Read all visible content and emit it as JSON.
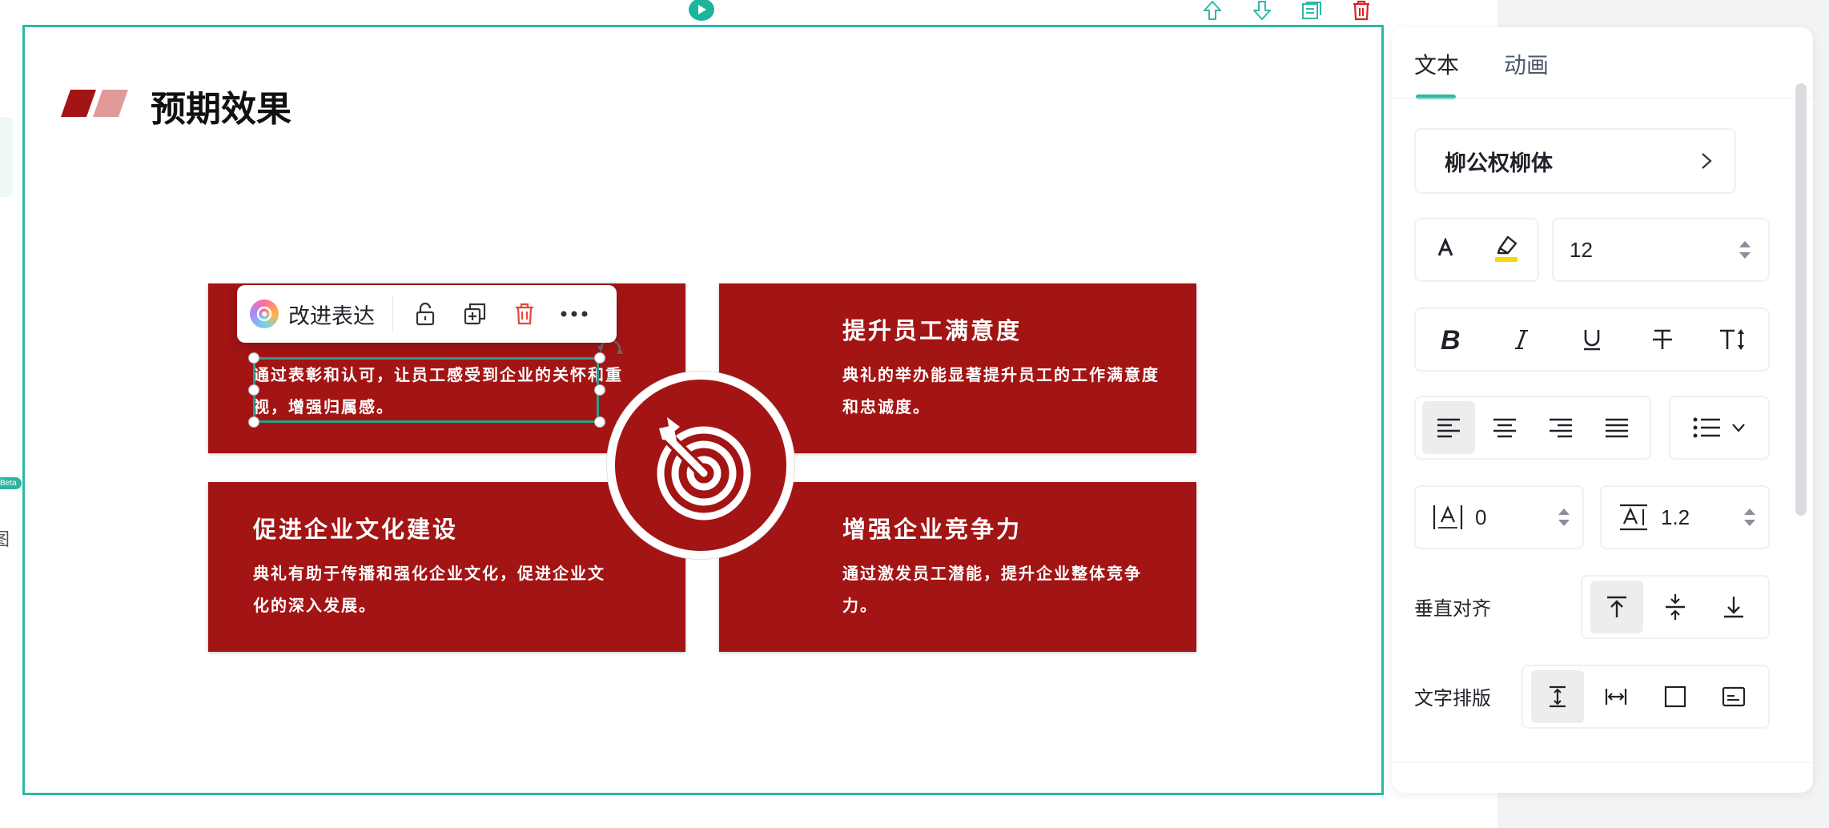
{
  "slide": {
    "title": "预期效果",
    "cards": [
      {
        "id": "top-left",
        "title": "",
        "text": "通过表彰和认可，让员工感受到企业的关怀和重视，增强归属感。"
      },
      {
        "id": "top-right",
        "title": "提升员工满意度",
        "text": "典礼的举办能显著提升员工的工作满意度和忠诚度。"
      },
      {
        "id": "bottom-left",
        "title": "促进企业文化建设",
        "text": "典礼有助于传播和强化企业文化，促进企业文化的深入发展。"
      },
      {
        "id": "bottom-right",
        "title": "增强企业竞争力",
        "text": "通过激发员工潜能，提升企业整体竞争力。"
      }
    ],
    "center_icon": "target-dart-icon",
    "accent_color": "#a31414",
    "selection_color": "#2db8a3"
  },
  "floating_toolbar": {
    "ai_label": "改进表达",
    "icons": [
      "unlock-icon",
      "duplicate-icon",
      "delete-icon",
      "more-icon"
    ]
  },
  "top_toolbar": {
    "icons": [
      "play-icon",
      "move-up-icon",
      "move-down-icon",
      "notes-icon",
      "trash-icon"
    ]
  },
  "left_edge": {
    "beta_badge": "Beta",
    "partial_char": "图"
  },
  "panel": {
    "tabs": [
      {
        "label": "文本",
        "active": true
      },
      {
        "label": "动画",
        "active": false
      }
    ],
    "font_name": "柳公权柳体",
    "font_size": "12",
    "highlight_color": "#f5d800",
    "letter_spacing": "0",
    "line_spacing": "1.2",
    "text_align": "left",
    "vertical_align_label": "垂直对齐",
    "vertical_align_active": "top",
    "text_layout_label": "文字排版",
    "text_layout_active": "auto-height"
  }
}
